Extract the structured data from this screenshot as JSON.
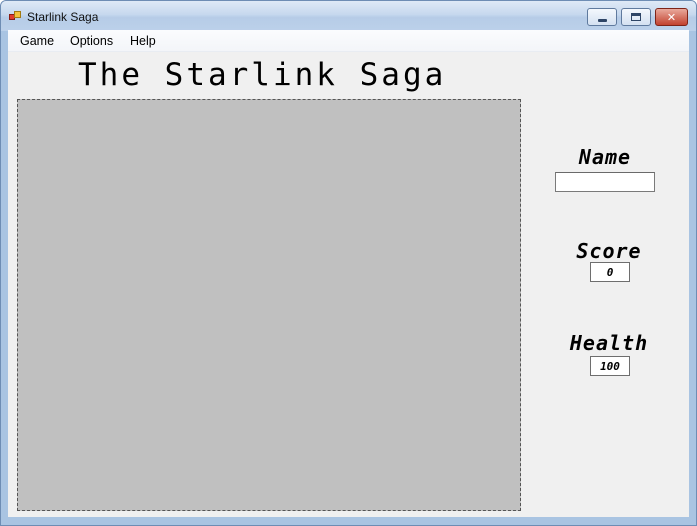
{
  "window": {
    "title": "Starlink Saga",
    "controls": {
      "minimize": "",
      "maximize": "",
      "close": "✕"
    }
  },
  "menu": {
    "items": [
      "Game",
      "Options",
      "Help"
    ]
  },
  "game": {
    "title": "The Starlink Saga"
  },
  "hud": {
    "name_label": "Name",
    "name_value": "",
    "score_label": "Score",
    "score_value": "0",
    "health_label": "Health",
    "health_value": "100"
  },
  "colors": {
    "client_background": "#f0f0f0",
    "play_area": "#c0c0c0"
  }
}
